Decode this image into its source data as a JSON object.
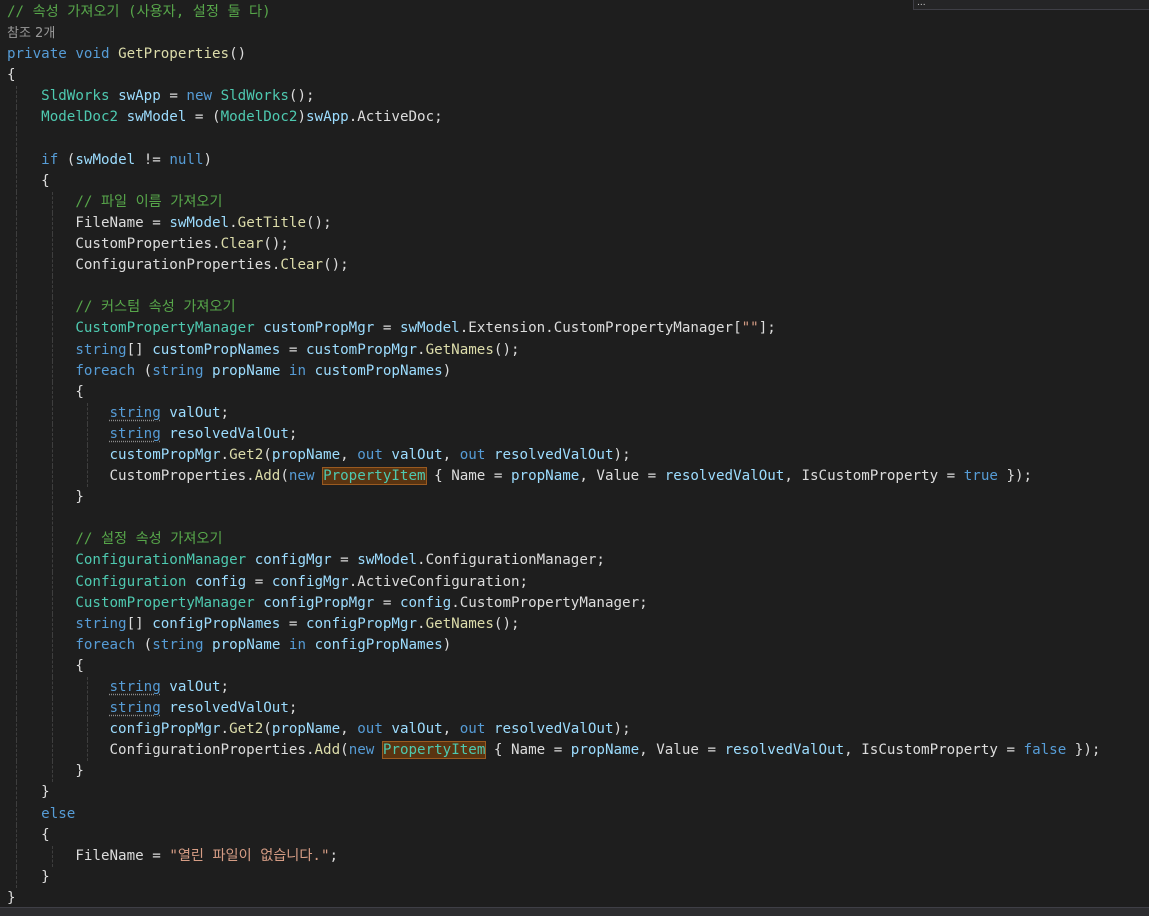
{
  "editor": {
    "language": "csharp",
    "find_widget_text": "...",
    "colors": {
      "background": "#1e1e1e",
      "comment": "#57a64a",
      "keyword": "#569cd6",
      "method": "#dcdcaa",
      "type": "#4ec9b0",
      "local_variable": "#9cdcfe",
      "string": "#d69d85",
      "highlight_background": "#5a3411"
    }
  },
  "lines": [
    {
      "indent": 0,
      "tokens": [
        {
          "t": "// 속성 가져오기 (사용자, 설정 둘 다)",
          "c": "cm"
        }
      ]
    },
    {
      "indent": 0,
      "codelens": true,
      "tokens": [
        {
          "t": "참조 2개",
          "c": "codelens"
        }
      ]
    },
    {
      "indent": 0,
      "tokens": [
        {
          "t": "private",
          "c": "kw"
        },
        {
          "t": " "
        },
        {
          "t": "void",
          "c": "kw"
        },
        {
          "t": " "
        },
        {
          "t": "GetProperties",
          "c": "fn"
        },
        {
          "t": "()"
        }
      ]
    },
    {
      "indent": 0,
      "tokens": [
        {
          "t": "{"
        }
      ]
    },
    {
      "indent": 1,
      "tokens": [
        {
          "t": "SldWorks",
          "c": "ty"
        },
        {
          "t": " "
        },
        {
          "t": "swApp",
          "c": "vr"
        },
        {
          "t": " = "
        },
        {
          "t": "new",
          "c": "kw"
        },
        {
          "t": " "
        },
        {
          "t": "SldWorks",
          "c": "ty"
        },
        {
          "t": "();"
        }
      ]
    },
    {
      "indent": 1,
      "tokens": [
        {
          "t": "ModelDoc2",
          "c": "ty"
        },
        {
          "t": " "
        },
        {
          "t": "swModel",
          "c": "vr"
        },
        {
          "t": " = ("
        },
        {
          "t": "ModelDoc2",
          "c": "ty"
        },
        {
          "t": ")"
        },
        {
          "t": "swApp",
          "c": "vr"
        },
        {
          "t": "."
        },
        {
          "t": "ActiveDoc",
          "c": "pr"
        },
        {
          "t": ";"
        }
      ]
    },
    {
      "indent": 1,
      "tokens": []
    },
    {
      "indent": 1,
      "tokens": [
        {
          "t": "if",
          "c": "kw"
        },
        {
          "t": " ("
        },
        {
          "t": "swModel",
          "c": "vr"
        },
        {
          "t": " != "
        },
        {
          "t": "null",
          "c": "kw"
        },
        {
          "t": ")"
        }
      ]
    },
    {
      "indent": 1,
      "tokens": [
        {
          "t": "{"
        }
      ]
    },
    {
      "indent": 2,
      "tokens": [
        {
          "t": "// 파일 이름 가져오기",
          "c": "cm"
        }
      ]
    },
    {
      "indent": 2,
      "tokens": [
        {
          "t": "FileName",
          "c": "pr"
        },
        {
          "t": " = "
        },
        {
          "t": "swModel",
          "c": "vr"
        },
        {
          "t": "."
        },
        {
          "t": "GetTitle",
          "c": "fn"
        },
        {
          "t": "();"
        }
      ]
    },
    {
      "indent": 2,
      "tokens": [
        {
          "t": "CustomProperties",
          "c": "pr"
        },
        {
          "t": "."
        },
        {
          "t": "Clear",
          "c": "fn"
        },
        {
          "t": "();"
        }
      ]
    },
    {
      "indent": 2,
      "tokens": [
        {
          "t": "ConfigurationProperties",
          "c": "pr"
        },
        {
          "t": "."
        },
        {
          "t": "Clear",
          "c": "fn"
        },
        {
          "t": "();"
        }
      ]
    },
    {
      "indent": 2,
      "tokens": []
    },
    {
      "indent": 2,
      "tokens": [
        {
          "t": "// 커스텀 속성 가져오기",
          "c": "cm"
        }
      ]
    },
    {
      "indent": 2,
      "tokens": [
        {
          "t": "CustomPropertyManager",
          "c": "ty"
        },
        {
          "t": " "
        },
        {
          "t": "customPropMgr",
          "c": "vr"
        },
        {
          "t": " = "
        },
        {
          "t": "swModel",
          "c": "vr"
        },
        {
          "t": "."
        },
        {
          "t": "Extension",
          "c": "pr"
        },
        {
          "t": "."
        },
        {
          "t": "CustomPropertyManager",
          "c": "pr"
        },
        {
          "t": "["
        },
        {
          "t": "\"\"",
          "c": "st"
        },
        {
          "t": "];"
        }
      ]
    },
    {
      "indent": 2,
      "tokens": [
        {
          "t": "string",
          "c": "kw"
        },
        {
          "t": "[] "
        },
        {
          "t": "customPropNames",
          "c": "vr"
        },
        {
          "t": " = "
        },
        {
          "t": "customPropMgr",
          "c": "vr"
        },
        {
          "t": "."
        },
        {
          "t": "GetNames",
          "c": "fn"
        },
        {
          "t": "();"
        }
      ]
    },
    {
      "indent": 2,
      "tokens": [
        {
          "t": "foreach",
          "c": "kw"
        },
        {
          "t": " ("
        },
        {
          "t": "string",
          "c": "kw"
        },
        {
          "t": " "
        },
        {
          "t": "propName",
          "c": "vr"
        },
        {
          "t": " "
        },
        {
          "t": "in",
          "c": "kw"
        },
        {
          "t": " "
        },
        {
          "t": "customPropNames",
          "c": "vr"
        },
        {
          "t": ")"
        }
      ]
    },
    {
      "indent": 2,
      "tokens": [
        {
          "t": "{"
        }
      ]
    },
    {
      "indent": 3,
      "tokens": [
        {
          "t": "string",
          "c": "kw sq"
        },
        {
          "t": " "
        },
        {
          "t": "valOut",
          "c": "vr"
        },
        {
          "t": ";"
        }
      ]
    },
    {
      "indent": 3,
      "tokens": [
        {
          "t": "string",
          "c": "kw sq"
        },
        {
          "t": " "
        },
        {
          "t": "resolvedValOut",
          "c": "vr"
        },
        {
          "t": ";"
        }
      ]
    },
    {
      "indent": 3,
      "tokens": [
        {
          "t": "customPropMgr",
          "c": "vr"
        },
        {
          "t": "."
        },
        {
          "t": "Get2",
          "c": "fn"
        },
        {
          "t": "("
        },
        {
          "t": "propName",
          "c": "vr"
        },
        {
          "t": ", "
        },
        {
          "t": "out",
          "c": "kw"
        },
        {
          "t": " "
        },
        {
          "t": "valOut",
          "c": "vr"
        },
        {
          "t": ", "
        },
        {
          "t": "out",
          "c": "kw"
        },
        {
          "t": " "
        },
        {
          "t": "resolvedValOut",
          "c": "vr"
        },
        {
          "t": ");"
        }
      ]
    },
    {
      "indent": 3,
      "tokens": [
        {
          "t": "CustomProperties",
          "c": "pr"
        },
        {
          "t": "."
        },
        {
          "t": "Add",
          "c": "fn"
        },
        {
          "t": "("
        },
        {
          "t": "new",
          "c": "kw"
        },
        {
          "t": " "
        },
        {
          "t": "PropertyItem",
          "c": "hl"
        },
        {
          "t": " { "
        },
        {
          "t": "Name",
          "c": "pr"
        },
        {
          "t": " = "
        },
        {
          "t": "propName",
          "c": "vr"
        },
        {
          "t": ", "
        },
        {
          "t": "Value",
          "c": "pr"
        },
        {
          "t": " = "
        },
        {
          "t": "resolvedValOut",
          "c": "vr"
        },
        {
          "t": ", "
        },
        {
          "t": "IsCustomProperty",
          "c": "pr"
        },
        {
          "t": " = "
        },
        {
          "t": "true",
          "c": "kw"
        },
        {
          "t": " });"
        }
      ]
    },
    {
      "indent": 2,
      "tokens": [
        {
          "t": "}"
        }
      ]
    },
    {
      "indent": 2,
      "tokens": []
    },
    {
      "indent": 2,
      "tokens": [
        {
          "t": "// 설정 속성 가져오기",
          "c": "cm"
        }
      ]
    },
    {
      "indent": 2,
      "tokens": [
        {
          "t": "ConfigurationManager",
          "c": "ty"
        },
        {
          "t": " "
        },
        {
          "t": "configMgr",
          "c": "vr"
        },
        {
          "t": " = "
        },
        {
          "t": "swModel",
          "c": "vr"
        },
        {
          "t": "."
        },
        {
          "t": "ConfigurationManager",
          "c": "pr"
        },
        {
          "t": ";"
        }
      ]
    },
    {
      "indent": 2,
      "tokens": [
        {
          "t": "Configuration",
          "c": "ty"
        },
        {
          "t": " "
        },
        {
          "t": "config",
          "c": "vr"
        },
        {
          "t": " = "
        },
        {
          "t": "configMgr",
          "c": "vr"
        },
        {
          "t": "."
        },
        {
          "t": "ActiveConfiguration",
          "c": "pr"
        },
        {
          "t": ";"
        }
      ]
    },
    {
      "indent": 2,
      "tokens": [
        {
          "t": "CustomPropertyManager",
          "c": "ty"
        },
        {
          "t": " "
        },
        {
          "t": "configPropMgr",
          "c": "vr"
        },
        {
          "t": " = "
        },
        {
          "t": "config",
          "c": "vr"
        },
        {
          "t": "."
        },
        {
          "t": "CustomPropertyManager",
          "c": "pr"
        },
        {
          "t": ";"
        }
      ]
    },
    {
      "indent": 2,
      "tokens": [
        {
          "t": "string",
          "c": "kw"
        },
        {
          "t": "[] "
        },
        {
          "t": "configPropNames",
          "c": "vr"
        },
        {
          "t": " = "
        },
        {
          "t": "configPropMgr",
          "c": "vr"
        },
        {
          "t": "."
        },
        {
          "t": "GetNames",
          "c": "fn"
        },
        {
          "t": "();"
        }
      ]
    },
    {
      "indent": 2,
      "tokens": [
        {
          "t": "foreach",
          "c": "kw"
        },
        {
          "t": " ("
        },
        {
          "t": "string",
          "c": "kw"
        },
        {
          "t": " "
        },
        {
          "t": "propName",
          "c": "vr"
        },
        {
          "t": " "
        },
        {
          "t": "in",
          "c": "kw"
        },
        {
          "t": " "
        },
        {
          "t": "configPropNames",
          "c": "vr"
        },
        {
          "t": ")"
        }
      ]
    },
    {
      "indent": 2,
      "tokens": [
        {
          "t": "{"
        }
      ]
    },
    {
      "indent": 3,
      "tokens": [
        {
          "t": "string",
          "c": "kw sq"
        },
        {
          "t": " "
        },
        {
          "t": "valOut",
          "c": "vr"
        },
        {
          "t": ";"
        }
      ]
    },
    {
      "indent": 3,
      "tokens": [
        {
          "t": "string",
          "c": "kw sq"
        },
        {
          "t": " "
        },
        {
          "t": "resolvedValOut",
          "c": "vr"
        },
        {
          "t": ";"
        }
      ]
    },
    {
      "indent": 3,
      "tokens": [
        {
          "t": "configPropMgr",
          "c": "vr"
        },
        {
          "t": "."
        },
        {
          "t": "Get2",
          "c": "fn"
        },
        {
          "t": "("
        },
        {
          "t": "propName",
          "c": "vr"
        },
        {
          "t": ", "
        },
        {
          "t": "out",
          "c": "kw"
        },
        {
          "t": " "
        },
        {
          "t": "valOut",
          "c": "vr"
        },
        {
          "t": ", "
        },
        {
          "t": "out",
          "c": "kw"
        },
        {
          "t": " "
        },
        {
          "t": "resolvedValOut",
          "c": "vr"
        },
        {
          "t": ");"
        }
      ]
    },
    {
      "indent": 3,
      "tokens": [
        {
          "t": "ConfigurationProperties",
          "c": "pr"
        },
        {
          "t": "."
        },
        {
          "t": "Add",
          "c": "fn"
        },
        {
          "t": "("
        },
        {
          "t": "new",
          "c": "kw"
        },
        {
          "t": " "
        },
        {
          "t": "PropertyItem",
          "c": "hl"
        },
        {
          "t": " { "
        },
        {
          "t": "Name",
          "c": "pr"
        },
        {
          "t": " = "
        },
        {
          "t": "propName",
          "c": "vr"
        },
        {
          "t": ", "
        },
        {
          "t": "Value",
          "c": "pr"
        },
        {
          "t": " = "
        },
        {
          "t": "resolvedValOut",
          "c": "vr"
        },
        {
          "t": ", "
        },
        {
          "t": "IsCustomProperty",
          "c": "pr"
        },
        {
          "t": " = "
        },
        {
          "t": "false",
          "c": "kw"
        },
        {
          "t": " });"
        }
      ]
    },
    {
      "indent": 2,
      "tokens": [
        {
          "t": "}"
        }
      ]
    },
    {
      "indent": 1,
      "tokens": [
        {
          "t": "}"
        }
      ]
    },
    {
      "indent": 1,
      "tokens": [
        {
          "t": "else",
          "c": "kw"
        }
      ]
    },
    {
      "indent": 1,
      "tokens": [
        {
          "t": "{"
        }
      ]
    },
    {
      "indent": 2,
      "tokens": [
        {
          "t": "FileName",
          "c": "pr"
        },
        {
          "t": " = "
        },
        {
          "t": "\"열린 파일이 없습니다.\"",
          "c": "st"
        },
        {
          "t": ";"
        }
      ]
    },
    {
      "indent": 1,
      "tokens": [
        {
          "t": "}"
        }
      ]
    },
    {
      "indent": 0,
      "tokens": [
        {
          "t": "}"
        }
      ]
    }
  ]
}
